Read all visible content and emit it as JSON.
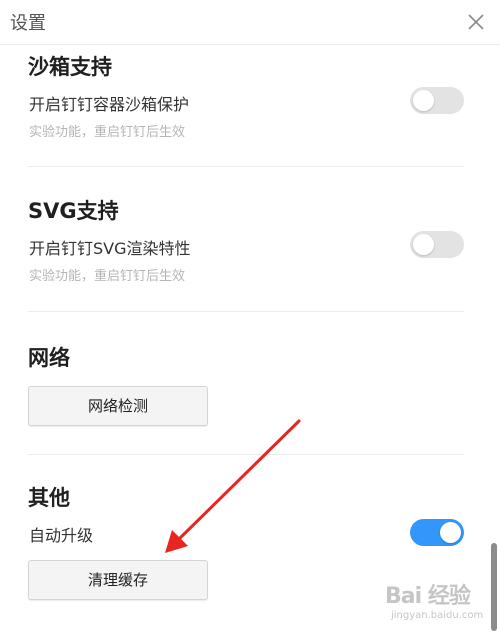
{
  "window": {
    "title": "设置"
  },
  "sections": {
    "sandbox": {
      "title": "沙箱支持",
      "label": "开启钉钉容器沙箱保护",
      "hint": "实验功能，重启钉钉后生效",
      "enabled": false
    },
    "svg": {
      "title": "SVG支持",
      "label": "开启钉钉SVG渲染特性",
      "hint": "实验功能，重启钉钉后生效",
      "enabled": false
    },
    "network": {
      "title": "网络",
      "button_label": "网络检测"
    },
    "other": {
      "title": "其他",
      "auto_upgrade_label": "自动升级",
      "auto_upgrade_enabled": true,
      "clear_cache_label": "清理缓存"
    }
  },
  "watermark": {
    "logo": "Bai 经验",
    "url": "jingyan.baidu.com"
  },
  "colors": {
    "toggle_on": "#3296fa",
    "toggle_off": "#e3e3e3",
    "annotation_arrow": "#e8251e"
  }
}
